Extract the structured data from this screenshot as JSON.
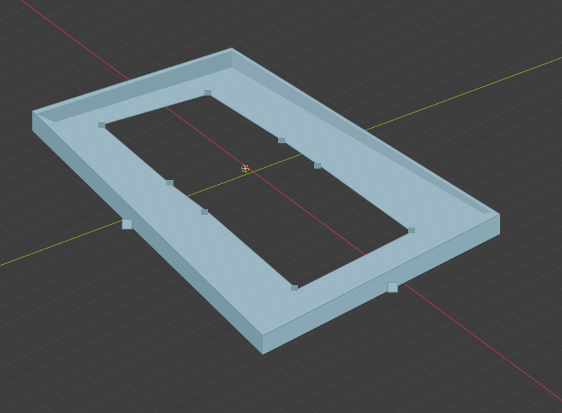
{
  "viewport": {
    "kind": "3d-viewport",
    "background": "#3d3d3d",
    "grid_color": "#4a4a4a"
  },
  "axes": {
    "x_axis_color": "#b03a48",
    "y_axis_color": "#7a9a2a"
  },
  "model": {
    "name": "enclosure-frame",
    "color_top": "#9cb8c4",
    "color_side_light": "#89a8b4",
    "color_side_dark": "#7898a4",
    "color_inner_wall": "#8aa6b2",
    "mesh_line_color": "#8ea9b5"
  },
  "cursor": {
    "name": "3d-cursor",
    "ring_color": "#e08a2a",
    "cross_color": "#ffffff"
  }
}
